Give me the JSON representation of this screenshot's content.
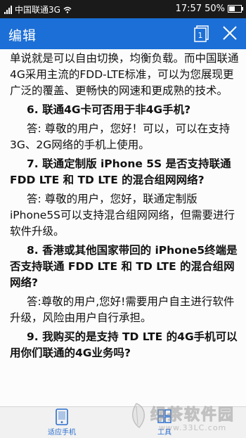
{
  "status_bar": {
    "carrier": "中国联通3G",
    "time": "17:57",
    "battery_text": "50%",
    "battery_level": 0.5,
    "signal_bars": 4
  },
  "app_bar": {
    "title": "编辑",
    "tab_count": "1",
    "icons": [
      "tab-count-icon",
      "close-icon"
    ],
    "color": "#1c6fd6"
  },
  "article": {
    "paragraphs": [
      {
        "kind": "a",
        "text": "单说就是可以自由切换，均衡负载。而中国联通4G采用主流的FDD-LTE标准，可以为您展现更广泛的覆盖、更畅快的网速和更成熟的技术。"
      },
      {
        "kind": "q",
        "text": "6. 联通4G卡可否用于非4G手机?"
      },
      {
        "kind": "a",
        "text": "答: 尊敬的用户，您好！可以，可以在支持3G、2G网络的手机上使用。"
      },
      {
        "kind": "q",
        "text": "7. 联通定制版 iPhone 5S 是否支持联通 FDD LTE 和 TD LTE 的混合组网网络?"
      },
      {
        "kind": "a",
        "text": "答:  尊敬的用户，您好，联通定制版iPhone5S可以支持混合组网网络，但需要进行软件升级。"
      },
      {
        "kind": "q",
        "text": "8. 香港或其他国家带回的 iPhone5终端是否支持联通 FDD LTE 和 TD LTE 的混合组网网络?"
      },
      {
        "kind": "a",
        "text": "答:尊敬的用户,您好!需要用户自主进行软件升级，风险由用户自行承担。"
      },
      {
        "kind": "q",
        "text": "9. 我购买的是支持 TD LTE 的4G手机可以用你们联通的4G业务吗?"
      }
    ]
  },
  "bottom_bar": {
    "items": [
      {
        "label": "适应手机",
        "icon": "phone-fit-icon"
      },
      {
        "label": "工具",
        "icon": "tools-icon"
      }
    ]
  },
  "watermark": {
    "logo_text": "绿茶软件园",
    "url": "www.33LC.com"
  }
}
